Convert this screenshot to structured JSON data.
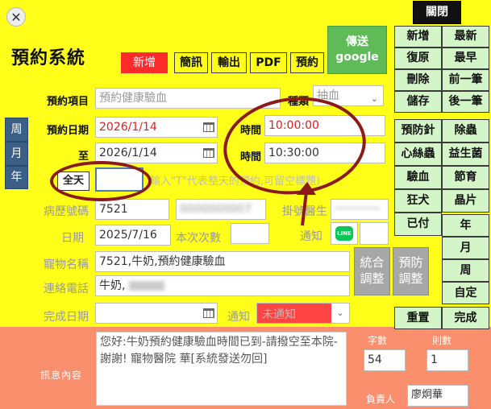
{
  "window": {
    "close_glyph": "✕",
    "close_label": "關閉"
  },
  "title": "預約系統",
  "top_tabs": [
    "新增",
    "簡訊",
    "輸出",
    "PDF",
    "預約"
  ],
  "send_button": {
    "line1": "傳送",
    "line2": "google"
  },
  "side_tabs": [
    "周",
    "月",
    "年"
  ],
  "right_actions": [
    [
      "新增",
      "最新"
    ],
    [
      "復原",
      "最早"
    ],
    [
      "刪除",
      "前一筆"
    ],
    [
      "儲存",
      "後一筆"
    ]
  ],
  "category_buttons": [
    [
      "預防針",
      "除蟲"
    ],
    [
      "心絲蟲",
      "益生菌"
    ],
    [
      "驗血",
      "節育"
    ],
    [
      "狂犬",
      "晶片"
    ],
    [
      "已付",
      "年"
    ]
  ],
  "range_buttons": [
    "月",
    "周",
    "自定"
  ],
  "bottom_actions": [
    "重置",
    "完成"
  ],
  "form": {
    "item_label": "預約項目",
    "item_value": "預約健康驗血",
    "type_label": "種類",
    "type_value": "抽血",
    "date_label": "預約日期",
    "date_value": "2026/1/14",
    "to_label": "至",
    "to_date_value": "2026/1/14",
    "time_label": "時間",
    "time_start": "10:00:00",
    "time_end": "10:30:00",
    "allday_label": "全天",
    "allday_hint": "輸入\"T\"代表整天的預約,可留空標題)",
    "record_label": "病歷號碼",
    "record_value": "7521",
    "record_extra": "0000000007",
    "doctor_label": "掛號醫生",
    "doctor_value": "一一一一",
    "visit_date_label": "日期",
    "visit_date_value": "2025/7/16",
    "visit_count_label": "本次次數",
    "notify_label": "通知",
    "line_icon_text": "LINE",
    "pet_label": "寵物名稱",
    "pet_value": "7521,牛奶,預約健康驗血",
    "phone_label": "連絡電話",
    "phone_value": "牛奶,",
    "stats_button": "統合\n調整",
    "prevent_button": "預防\n調整",
    "done_date_label": "完成日期",
    "done_notify_label": "通知",
    "notify_status": "未通知"
  },
  "footer": {
    "message_label": "訊息內容",
    "message_text": "您好:牛奶預約健康驗血時間已到-請撥空至本院-謝謝! 寵物醫院              華[系統發送勿回]",
    "char_count_label": "字數",
    "char_count_value": "54",
    "msg_count_label": "則數",
    "msg_count_value": "1",
    "owner_label": "負責人",
    "owner_value": "廖炯華"
  }
}
